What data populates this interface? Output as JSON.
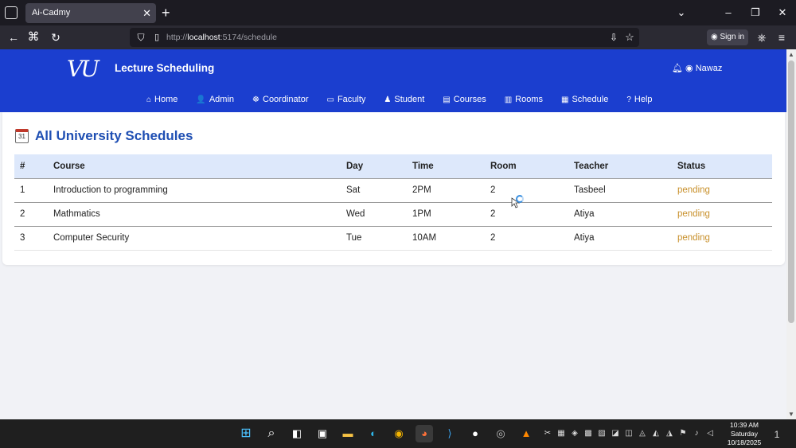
{
  "browser": {
    "tab_title": "Ai-Cadmy",
    "tab_close": "✕",
    "new_tab": "+",
    "url_prefix": "http://",
    "url_host": "localhost",
    "url_path": ":5174/schedule",
    "sign_in": "Sign in"
  },
  "app": {
    "logo": "VU",
    "title": "Lecture Scheduling",
    "user_name": "Nawaz",
    "menu": [
      {
        "label": "Home",
        "icon": "home-icon",
        "glyph": "⌂"
      },
      {
        "label": "Admin",
        "icon": "user-gear-icon",
        "glyph": "👤"
      },
      {
        "label": "Coordinator",
        "icon": "users-icon",
        "glyph": "☸"
      },
      {
        "label": "Faculty",
        "icon": "chalkboard-icon",
        "glyph": "▭"
      },
      {
        "label": "Student",
        "icon": "graduate-icon",
        "glyph": "♟"
      },
      {
        "label": "Courses",
        "icon": "book-icon",
        "glyph": "▤"
      },
      {
        "label": "Rooms",
        "icon": "door-icon",
        "glyph": "▥"
      },
      {
        "label": "Schedule",
        "icon": "calendar-icon",
        "glyph": "▦"
      },
      {
        "label": "Help",
        "icon": "question-icon",
        "glyph": "?"
      }
    ]
  },
  "page": {
    "calendar_day": "31",
    "title": "All University Schedules"
  },
  "table": {
    "headers": [
      "#",
      "Course",
      "Day",
      "Time",
      "Room",
      "Teacher",
      "Status"
    ],
    "rows": [
      {
        "num": "1",
        "course": "Introduction to programming",
        "day": "Sat",
        "time": "2PM",
        "room": "2",
        "teacher": "Tasbeel",
        "status": "pending"
      },
      {
        "num": "2",
        "course": "Mathmatics",
        "day": "Wed",
        "time": "1PM",
        "room": "2",
        "teacher": "Atiya",
        "status": "pending"
      },
      {
        "num": "3",
        "course": "Computer Security",
        "day": "Tue",
        "time": "10AM",
        "room": "2",
        "teacher": "Atiya",
        "status": "pending"
      }
    ]
  },
  "taskbar": {
    "time": "10:39 AM",
    "day": "Saturday",
    "date": "10/18/2025",
    "notification_count": "1"
  },
  "colors": {
    "header_bg": "#1b3ecf",
    "title_blue": "#1f4fb3",
    "status_pending": "#c8902b",
    "table_header_bg": "#dde8fb"
  }
}
